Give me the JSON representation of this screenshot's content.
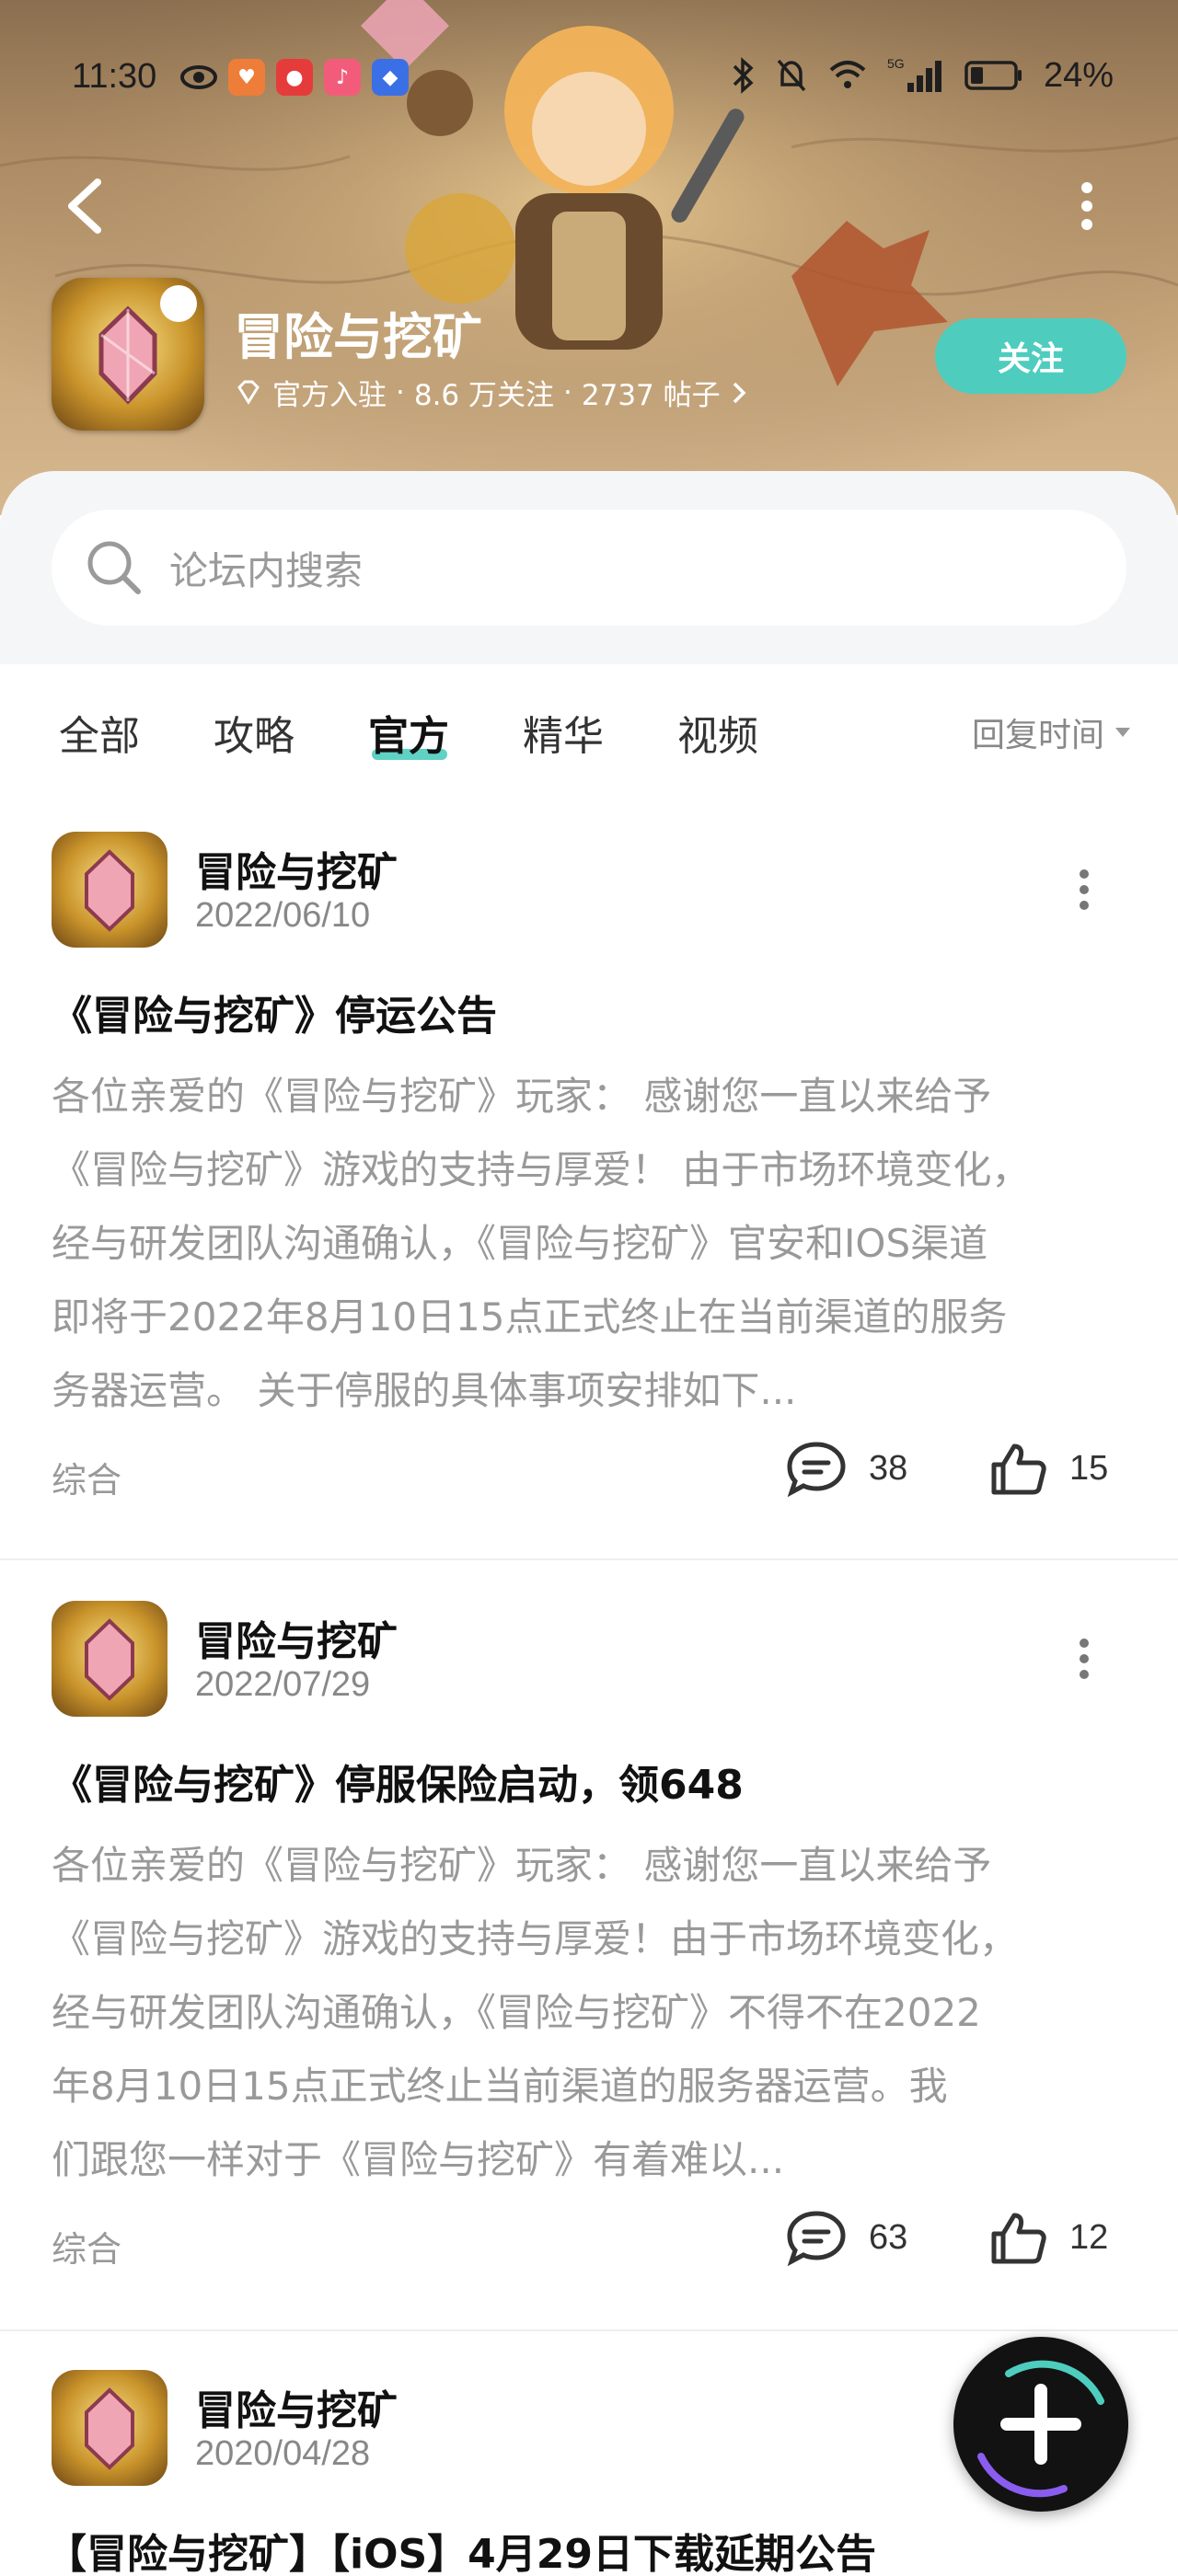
{
  "status_bar": {
    "time": "11:30",
    "battery": "24%",
    "network_label": "5G"
  },
  "forum": {
    "name": "冒险与挖矿",
    "official_label": "官方入驻",
    "followers": "8.6 万关注",
    "posts_count": "2737 帖子",
    "separator": "·",
    "follow_label": "关注"
  },
  "search": {
    "placeholder": "论坛内搜索"
  },
  "tabs": [
    {
      "label": "全部"
    },
    {
      "label": "攻略"
    },
    {
      "label": "官方"
    },
    {
      "label": "精华"
    },
    {
      "label": "视频"
    }
  ],
  "active_tab": "官方",
  "sort": {
    "label": "回复时间"
  },
  "posts": [
    {
      "author": "冒险与挖矿",
      "date": "2022/06/10",
      "title": "《冒险与挖矿》停运公告",
      "excerpt_lines": [
        "各位亲爱的《冒险与挖矿》玩家： 感谢您一直以来给予",
        "《冒险与挖矿》游戏的支持与厚爱！ 由于市场环境变化，",
        "经与研发团队沟通确认，《冒险与挖矿》官安和IOS渠道",
        "即将于2022年8月10日15点正式终止在当前渠道的服务",
        "务器运营。 关于停服的具体事项安排如下..."
      ],
      "category": "综合",
      "comments": "38",
      "likes": "15"
    },
    {
      "author": "冒险与挖矿",
      "date": "2022/07/29",
      "title": "《冒险与挖矿》停服保险启动，领648",
      "excerpt_lines": [
        "各位亲爱的《冒险与挖矿》玩家： 感谢您一直以来给予",
        "《冒险与挖矿》游戏的支持与厚爱！由于市场环境变化，",
        "经与研发团队沟通确认，《冒险与挖矿》不得不在2022",
        "年8月10日15点正式终止当前渠道的服务器运营。我",
        "们跟您一样对于《冒险与挖矿》有着难以..."
      ],
      "category": "综合",
      "comments": "63",
      "likes": "12"
    },
    {
      "author": "冒险与挖矿",
      "date": "2020/04/28",
      "title": "【冒险与挖矿】【iOS】4月29日下载延期公告"
    }
  ],
  "colors": {
    "accent": "#4ecdbf",
    "banner": "#b08e67",
    "muted_text": "#999999"
  },
  "icons": {
    "back": "chevron-left-icon",
    "more": "more-vertical-icon",
    "search": "search-icon",
    "comment": "comment-icon",
    "like": "thumbs-up-icon",
    "compose": "plus-icon",
    "official": "diamond-icon"
  }
}
